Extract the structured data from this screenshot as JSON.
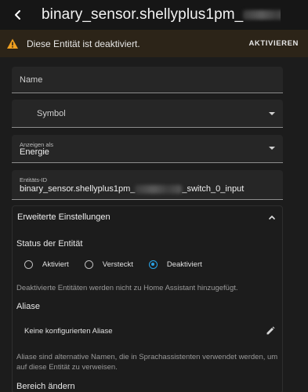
{
  "header": {
    "title_prefix": "binary_sensor.shellyplus1pm_",
    "back_icon": "arrow-left-icon"
  },
  "warning": {
    "icon": "alert-triangle-icon",
    "message": "Diese Entität ist deaktiviert.",
    "action": "AKTIVIEREN",
    "accent_color": "#f0a020"
  },
  "form": {
    "name_label": "Name",
    "symbol_label": "Symbol",
    "show_as_label": "Anzeigen als",
    "show_as_value": "Energie",
    "entity_id_label": "Entitäts-ID",
    "entity_id_prefix": "binary_sensor.shellyplus1pm_",
    "entity_id_suffix": "_switch_0_input"
  },
  "advanced": {
    "title": "Erweiterte Einstellungen",
    "status_title": "Status der Entität",
    "options": [
      "Aktiviert",
      "Versteckt",
      "Deaktiviert"
    ],
    "selected": "Deaktiviert",
    "disabled_helper": "Deaktivierte Entitäten werden nicht zu Home Assistant hinzugefügt.",
    "aliases_title": "Aliase",
    "aliases_empty": "Keine konfigurierten Aliase",
    "aliases_helper": "Aliase sind alternative Namen, die in Sprachassistenten verwendet werden, um auf diese Entität zu verweisen.",
    "area_title": "Bereich ändern"
  },
  "colors": {
    "radio_selected": "#29a3e6"
  }
}
